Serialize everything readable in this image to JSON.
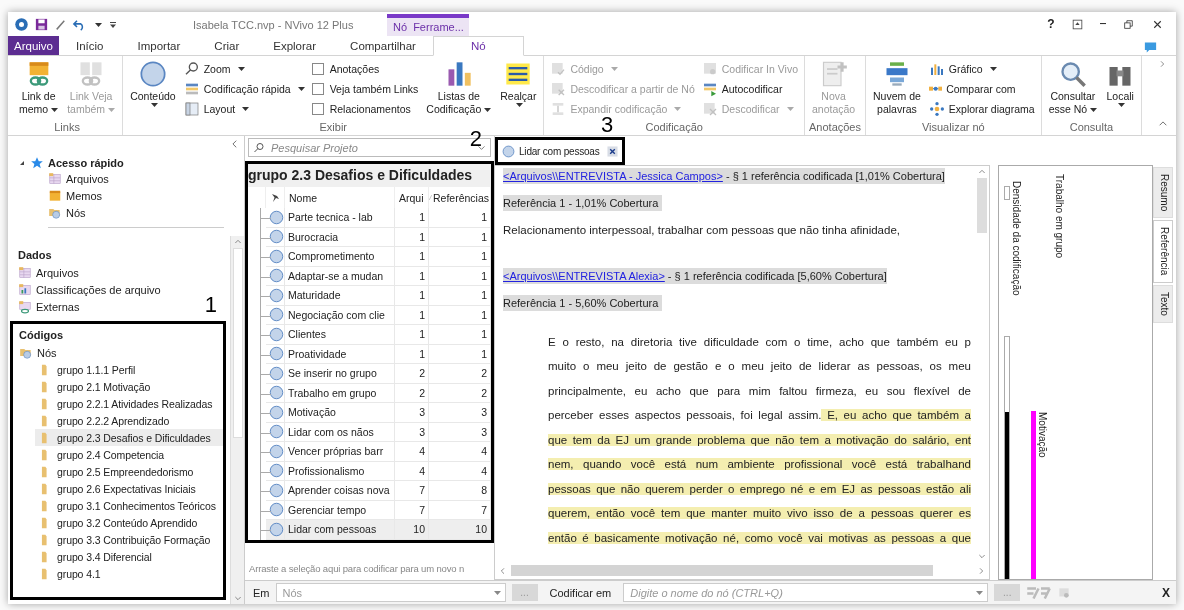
{
  "window": {
    "title": "Isabela TCC.nvp - NVivo 12 Plus",
    "context_tab": "Nó  Ferrame...",
    "help": "?"
  },
  "ribbon": {
    "tabs": [
      {
        "label": "Arquivo",
        "kind": "file",
        "selected": false
      },
      {
        "label": "Início",
        "kind": "tab",
        "selected": false
      },
      {
        "label": "Importar",
        "kind": "tab",
        "selected": false
      },
      {
        "label": "Criar",
        "kind": "tab",
        "selected": false
      },
      {
        "label": "Explorar",
        "kind": "tab",
        "selected": false
      },
      {
        "label": "Compartilhar",
        "kind": "tab",
        "selected": false
      },
      {
        "label": "Nó",
        "kind": "tab",
        "selected": true
      }
    ],
    "groups": [
      {
        "label": "Links",
        "columns": [
          {
            "kind": "large",
            "label": "Link de\nmemo",
            "dropdown": true,
            "disabled": false
          },
          {
            "kind": "large",
            "label": "Link Veja\ntambém",
            "dropdown": true,
            "disabled": true
          }
        ]
      },
      {
        "label": "Exibir",
        "columns": [
          {
            "kind": "split",
            "label": "Conteúdo",
            "dropdown": true,
            "disabled": false
          },
          {
            "kind": "stack",
            "items": [
              {
                "kind": "button",
                "label": "Zoom",
                "dropdown": true,
                "disabled": false
              },
              {
                "kind": "button",
                "label": "Codificação rápida",
                "dropdown": true,
                "disabled": false
              },
              {
                "kind": "button",
                "label": "Layout",
                "dropdown": true,
                "disabled": false
              }
            ]
          },
          {
            "kind": "stack",
            "items": [
              {
                "kind": "check",
                "label": "Anotações",
                "checked": false
              },
              {
                "kind": "check",
                "label": "Veja também Links",
                "checked": false
              },
              {
                "kind": "check",
                "label": "Relacionamentos",
                "checked": false
              }
            ]
          },
          {
            "kind": "large",
            "label": "Listas de\nCodificação",
            "dropdown": true,
            "disabled": false
          },
          {
            "kind": "split",
            "label": "Realçar",
            "dropdown": true,
            "disabled": false
          }
        ]
      },
      {
        "label": "Codificação",
        "columns": [
          {
            "kind": "stack",
            "items": [
              {
                "kind": "button",
                "label": "Código",
                "dropdown": true,
                "disabled": true
              },
              {
                "kind": "button",
                "label": "Descodificar a partir de Nó",
                "dropdown": false,
                "disabled": true
              },
              {
                "kind": "button",
                "label": "Expandir codificação",
                "dropdown": true,
                "disabled": true
              }
            ]
          },
          {
            "kind": "stack",
            "items": [
              {
                "kind": "button",
                "label": "Codificar In Vivo",
                "dropdown": false,
                "disabled": true
              },
              {
                "kind": "button",
                "label": "Autocodificar",
                "dropdown": false,
                "disabled": false
              },
              {
                "kind": "button",
                "label": "Descodificar",
                "dropdown": true,
                "disabled": true
              }
            ]
          }
        ]
      },
      {
        "label": "Anotações",
        "columns": [
          {
            "kind": "large",
            "label": "Nova\nanotação",
            "dropdown": false,
            "disabled": true
          }
        ]
      },
      {
        "label": "Visualizar nó",
        "columns": [
          {
            "kind": "large",
            "label": "Nuvem de\npalavras",
            "dropdown": false,
            "disabled": false
          },
          {
            "kind": "stack",
            "items": [
              {
                "kind": "button",
                "label": "Gráfico",
                "dropdown": true,
                "disabled": false
              },
              {
                "kind": "button",
                "label": "Comparar com",
                "dropdown": false,
                "disabled": false
              },
              {
                "kind": "button",
                "label": "Explorar diagrama",
                "dropdown": false,
                "disabled": false
              }
            ]
          }
        ]
      },
      {
        "label": "Consulta",
        "columns": [
          {
            "kind": "large",
            "label": "Consultar\nesse Nó",
            "dropdown": true,
            "disabled": false
          },
          {
            "kind": "split",
            "label": "Locali",
            "dropdown": true,
            "disabled": false
          }
        ]
      }
    ]
  },
  "navigation": {
    "quick_access": {
      "title": "Acesso rápido",
      "expanded": true,
      "items": [
        {
          "label": "Arquivos"
        },
        {
          "label": "Memos"
        },
        {
          "label": "Nós"
        }
      ]
    },
    "data": {
      "title": "Dados",
      "items": [
        {
          "label": "Arquivos"
        },
        {
          "label": "Classificações de arquivo"
        },
        {
          "label": "Externas"
        }
      ]
    },
    "codes": {
      "title": "Códigos",
      "callout": "1",
      "root": "Nós",
      "children": [
        {
          "label": "grupo 1.1.1 Perfil",
          "selected": false
        },
        {
          "label": "grupo 2.1 Motivação",
          "selected": false
        },
        {
          "label": "grupo 2.2.1 Atividades Realizadas",
          "selected": false
        },
        {
          "label": "grupo 2.2.2 Aprendizado",
          "selected": false
        },
        {
          "label": "grupo 2.3 Desafios e Dificuldades",
          "selected": true
        },
        {
          "label": "grupo 2.4 Competencia",
          "selected": false
        },
        {
          "label": "grupo 2.5 Empreendedorismo",
          "selected": false
        },
        {
          "label": "grupo 2.6 Expectativas Iniciais",
          "selected": false
        },
        {
          "label": "grupo 3.1 Conhecimentos Teóricos",
          "selected": false
        },
        {
          "label": "grupo 3.2 Conteúdo Aprendido",
          "selected": false
        },
        {
          "label": "grupo 3.3 Contribuição Formação",
          "selected": false
        },
        {
          "label": "grupo 3.4 Diferencial",
          "selected": false
        },
        {
          "label": "grupo 4.1",
          "selected": false
        }
      ]
    }
  },
  "node_list": {
    "search_placeholder": "Pesquisar Projeto",
    "callout": "2",
    "title": "grupo 2.3 Desafios e Dificuldades",
    "columns": [
      "Nome",
      "Arqui",
      "Referências"
    ],
    "rows": [
      {
        "name": "Parte tecnica - lab",
        "files": "1",
        "references": "1",
        "selected": false
      },
      {
        "name": "Burocracia",
        "files": "1",
        "references": "1",
        "selected": false
      },
      {
        "name": "Comprometimento",
        "files": "1",
        "references": "1",
        "selected": false
      },
      {
        "name": "Adaptar-se a mudan",
        "files": "1",
        "references": "1",
        "selected": false
      },
      {
        "name": "Maturidade",
        "files": "1",
        "references": "1",
        "selected": false
      },
      {
        "name": "Negociação com clie",
        "files": "1",
        "references": "1",
        "selected": false
      },
      {
        "name": "Clientes",
        "files": "1",
        "references": "1",
        "selected": false
      },
      {
        "name": "Proatividade",
        "files": "1",
        "references": "1",
        "selected": false
      },
      {
        "name": "Se inserir no grupo",
        "files": "2",
        "references": "2",
        "selected": false
      },
      {
        "name": "Trabalho em grupo",
        "files": "2",
        "references": "2",
        "selected": false
      },
      {
        "name": "Motivação",
        "files": "3",
        "references": "3",
        "selected": false
      },
      {
        "name": "Lidar com os nãos",
        "files": "3",
        "references": "3",
        "selected": false
      },
      {
        "name": "Vencer próprias barr",
        "files": "4",
        "references": "4",
        "selected": false
      },
      {
        "name": "Profissionalismo",
        "files": "4",
        "references": "4",
        "selected": false
      },
      {
        "name": "Aprender coisas nova",
        "files": "7",
        "references": "8",
        "selected": false
      },
      {
        "name": "Gerenciar tempo",
        "files": "7",
        "references": "7",
        "selected": false
      },
      {
        "name": "Lidar com pessoas",
        "files": "10",
        "references": "10",
        "selected": true
      }
    ],
    "drop_hint": "Arraste a seleção aqui para codificar para um novo n"
  },
  "detail": {
    "tab": {
      "label": "Lidar com pessoas",
      "callout": "3"
    },
    "blocks": [
      {
        "kind": "source",
        "link": "<Arquivos\\\\ENTREVISTA - Jessica Campos>",
        "text": " - § 1 referência codificada  [1,01% Cobertura]"
      },
      {
        "kind": "reference",
        "text": "Referência 1 - 1,01% Cobertura"
      },
      {
        "kind": "paragraph",
        "text": "Relacionamento interpessoal, trabalhar com pessoas que não tinha afinidade,"
      },
      {
        "kind": "source",
        "link": "<Arquivos\\\\ENTREVISTA Alexia>",
        "text": " - § 1 referência codificada  [5,60% Cobertura]"
      },
      {
        "kind": "reference",
        "text": "Referência 1 - 5,60% Cobertura"
      },
      {
        "kind": "quote",
        "lines": [
          {
            "segments": [
              {
                "text": "E o resto, na diretoria tive dificuldade com o time, acho que também eu p",
                "highlighted": false
              }
            ]
          },
          {
            "segments": [
              {
                "text": "muito o meu jeito de gestão e o meu jeito de liderar as pessoas, os meu",
                "highlighted": false
              }
            ]
          },
          {
            "segments": [
              {
                "text": "principalmente, eu acho que para mim faltou firmeza, eu sou flexível de",
                "highlighted": false
              }
            ]
          },
          {
            "segments": [
              {
                "text": "perceber esses aspectos pessoais, foi legal assim.",
                "highlighted": false
              },
              {
                "text": "E, eu acho que também a",
                "highlighted": true
              }
            ]
          },
          {
            "segments": [
              {
                "text": "que tem da EJ um grande problema que não tem a motivação do salário, ent",
                "highlighted": true
              }
            ]
          },
          {
            "segments": [
              {
                "text": "nem, quando você está num ambiente profissional você está trabalhand",
                "highlighted": true
              }
            ]
          },
          {
            "segments": [
              {
                "text": "pessoas que não querem perder o emprego né e em EJ as pessoas estão ali",
                "highlighted": true
              }
            ]
          },
          {
            "segments": [
              {
                "text": "querem, então você tem que manter muito vivo isso de a pessoas querer es",
                "highlighted": true
              }
            ]
          },
          {
            "segments": [
              {
                "text": "então é basicamente motivação né, como você vai motivas as pessoas a que",
                "highlighted": true
              }
            ]
          }
        ]
      }
    ]
  },
  "coding_stripes": {
    "density_label": "Densidade da codificação",
    "stripes": [
      {
        "kind": "label",
        "label": "Trabalho em grupo"
      },
      {
        "kind": "bar",
        "label": "Motivação",
        "color": "#ff00ff"
      }
    ]
  },
  "side_tabs": [
    {
      "label": "Resumo",
      "selected": false
    },
    {
      "label": "Referência",
      "selected": true
    },
    {
      "label": "Texto",
      "selected": false
    }
  ],
  "code_bar": {
    "in_label": "Em",
    "in_placeholder": "Nós",
    "in_button": "...",
    "code_label": "Codificar em",
    "code_placeholder": "Digite o nome do nó (CTRL+Q)",
    "code_button": "...",
    "close": "X"
  }
}
